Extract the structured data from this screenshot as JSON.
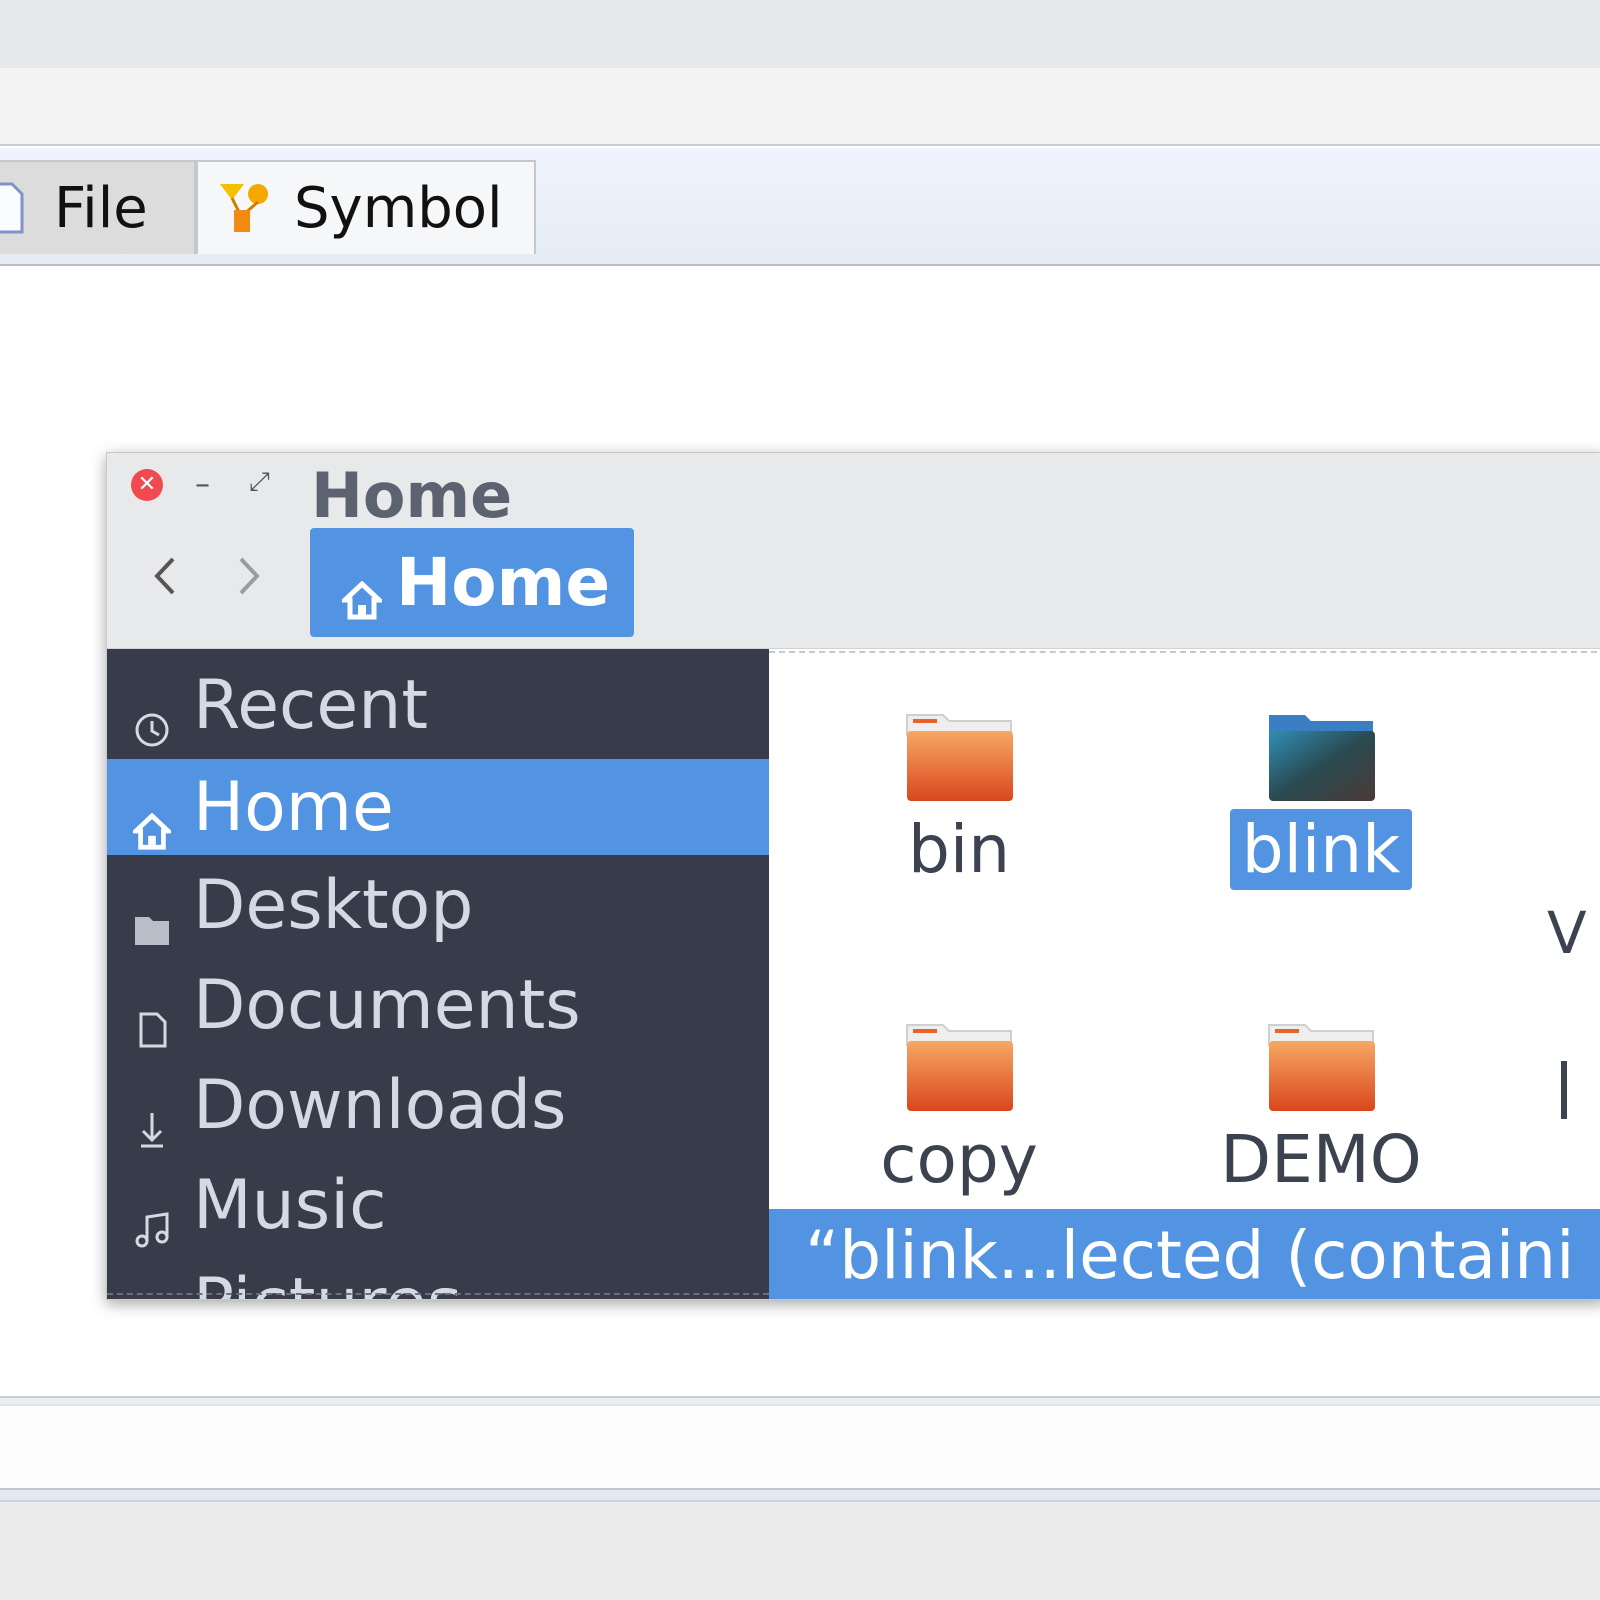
{
  "tabs": [
    {
      "label": "File",
      "icon": "file-icon"
    },
    {
      "label": "Symbol",
      "icon": "symbol-icon"
    }
  ],
  "window": {
    "title": "Home",
    "path": {
      "label": "Home",
      "icon": "home-icon"
    }
  },
  "sidebar": {
    "items": [
      {
        "label": "Recent",
        "icon": "clock-icon"
      },
      {
        "label": "Home",
        "icon": "home-icon",
        "active": true
      },
      {
        "label": "Desktop",
        "icon": "folder-icon"
      },
      {
        "label": "Documents",
        "icon": "document-icon"
      },
      {
        "label": "Downloads",
        "icon": "download-icon"
      },
      {
        "label": "Music",
        "icon": "music-icon"
      },
      {
        "label": "Pictures",
        "icon": "picture-icon"
      }
    ]
  },
  "files": {
    "items": [
      {
        "name": "bin",
        "color": "orange"
      },
      {
        "name": "blink",
        "color": "teal",
        "selected": true
      },
      {
        "name": "copy",
        "color": "orange"
      },
      {
        "name": "DEMO",
        "color": "orange"
      }
    ],
    "edge_letter": "V"
  },
  "status": {
    "text": "“blink...lected (containi"
  },
  "colors": {
    "accent": "#5294e2",
    "sidebar_bg": "#383c4a",
    "close_button": "#f04a50",
    "folder_orange": "#e8632c"
  }
}
